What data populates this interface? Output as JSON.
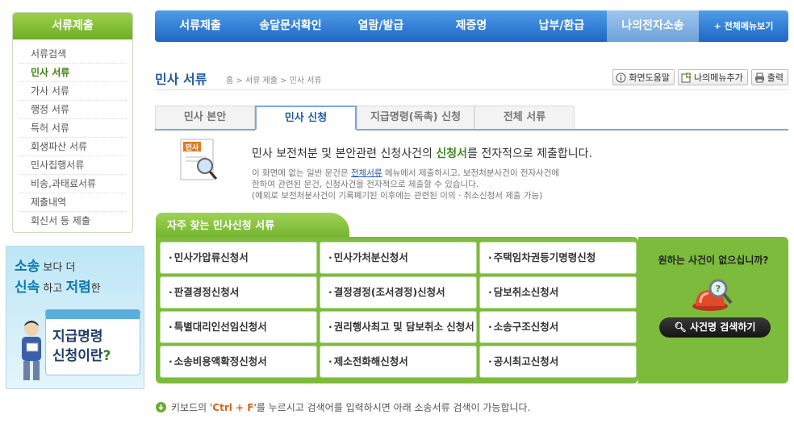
{
  "sidebar": {
    "title": "서류제출",
    "items": [
      "서류검색",
      "민사 서류",
      "가사 서류",
      "행정 서류",
      "특허 서류",
      "회생파산 서류",
      "민사집행서류",
      "비송,과태료서류",
      "제출내역",
      "회신서 등 제출"
    ],
    "active_index": 1
  },
  "banner": {
    "w1": "소송",
    "t1": " 보다 더",
    "w2": "신속",
    "t2": " 하고 ",
    "w3": "저렴",
    "t3": "한",
    "card_line1": "지급명령",
    "card_line2": "신청이란",
    "card_q": "?"
  },
  "topnav": {
    "items": [
      "서류제출",
      "송달문서확인",
      "열람/발급",
      "제증명",
      "납부/환급",
      "나의전자소송"
    ],
    "active_index": 5,
    "all_menu": "+ 전체메뉴보기"
  },
  "header": {
    "title": "민사 서류",
    "breadcrumb": "홈 > 서류 제출 > 민사 서류",
    "help": "화면도움말",
    "add_menu": "나의메뉴추가",
    "print": "출력"
  },
  "tabs": {
    "items": [
      "민사 본안",
      "민사 신청",
      "지급명령(독촉) 신청",
      "전체 서류"
    ],
    "active_index": 1
  },
  "intro": {
    "icon_label": "민사",
    "main_a": "민사 보전처분 및 본안관련 신청사건의 ",
    "main_hl": "신청서",
    "main_b": "를 전자적으로 제출합니다.",
    "sub1_a": "이 화면에 없는 일반 문건은 ",
    "sub1_link": "전체서류",
    "sub1_b": " 메뉴에서 제출하시고, 보전처분사건이 전자사건에",
    "sub2": "한하여 관련된 문건, 신청사건을 전자적으로 제출할 수 있습니다.",
    "sub3": "(예외로 보전처분사건이 기록폐기된 이후에는 관련된 이의 · 취소신청서 제출 가능)"
  },
  "frequent": {
    "title": "자주 찾는 민사신청 서류",
    "items": [
      "민사가압류신청서",
      "민사가처분신청서",
      "주택임차권등기명령신청",
      "판결경정신청서",
      "결정경정(조서경정)신청서",
      "담보취소신청서",
      "특별대리인선임신청서",
      "권리행사최고 및 담보취소 신청서",
      "소송구조신청서",
      "소송비용액확정신청서",
      "제소전화해신청서",
      "공시최고신청서"
    ]
  },
  "search_box": {
    "question": "원하는 사건이 없으십니까?",
    "button": "사건명 검색하기"
  },
  "note": {
    "a": "키보드의 '",
    "key": "Ctrl + F",
    "b": "'를 누르시고 검색어를 입력하시면 아래 소송서류 검색이 가능합니다."
  },
  "colors": {
    "green": "#7cbb3c",
    "blue_nav": "#2f7bd3",
    "title_blue": "#1e5a9e"
  }
}
